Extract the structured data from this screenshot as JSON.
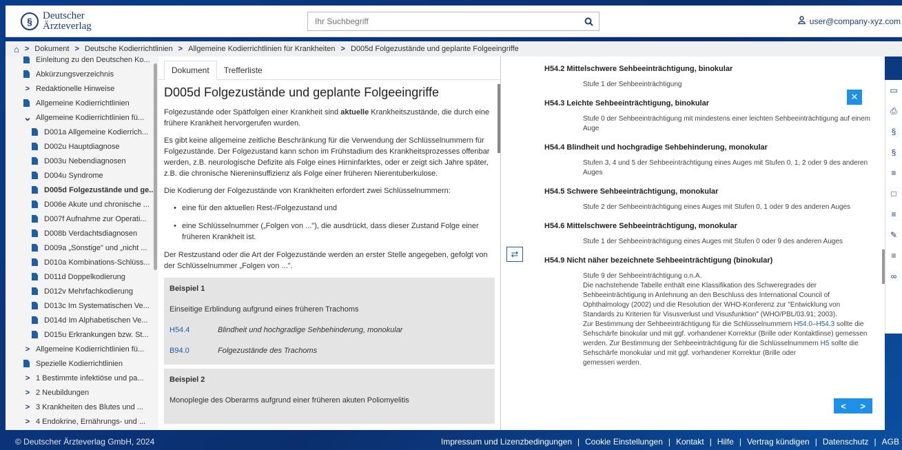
{
  "header": {
    "logo_line1": "Deutscher",
    "logo_line2": "Ärzteverlag",
    "search_placeholder": "Ihr Suchbegriff",
    "user": "user@company-xyz.com"
  },
  "breadcrumb": [
    "Dokument",
    "Deutsche Kodierrichtlinien",
    "Allgemeine Kodierrichtlinien für Krankheiten",
    "D005d Folgezustände und geplante Folgeeingriffe"
  ],
  "sidebar": {
    "items": [
      {
        "type": "doc",
        "label": "Einleitung zu den Deutschen Ko..."
      },
      {
        "type": "doc",
        "label": "Abkürzungsverzeichnis"
      },
      {
        "type": "chevron-right",
        "label": "Redaktionelle Hinweise"
      },
      {
        "type": "doc",
        "label": "Allgemeine Kodierrichtlinien"
      },
      {
        "type": "chevron-down",
        "label": "Allgemeine Kodierrichtlinien fü..."
      },
      {
        "type": "subdoc",
        "label": "D001a Allgemeine Kodierrich..."
      },
      {
        "type": "subdoc",
        "label": "D002u Hauptdiagnose"
      },
      {
        "type": "subdoc",
        "label": "D003u Nebendiagnosen"
      },
      {
        "type": "subdoc",
        "label": "D004u Syndrome"
      },
      {
        "type": "subdoc-active",
        "label": "D005d Folgezustände und ge..."
      },
      {
        "type": "subdoc",
        "label": "D006e Akute und chronische ..."
      },
      {
        "type": "subdoc",
        "label": "D007f Aufnahme zur Operati..."
      },
      {
        "type": "subdoc",
        "label": "D008b Verdachtsdiagnosen"
      },
      {
        "type": "subdoc",
        "label": "D009a „Sonstige\" und „nicht ..."
      },
      {
        "type": "subdoc",
        "label": "D010a Kombinations-Schlüss..."
      },
      {
        "type": "subdoc",
        "label": "D011d Doppelkodierung"
      },
      {
        "type": "subdoc",
        "label": "D012v Mehrfachkodierung"
      },
      {
        "type": "subdoc",
        "label": "D013c Im Systematischen Ve..."
      },
      {
        "type": "subdoc",
        "label": "D014d Im Alphabetischen Ve..."
      },
      {
        "type": "subdoc",
        "label": "D015u Erkrankungen bzw. St..."
      },
      {
        "type": "chevron-right",
        "label": "Allgemeine Kodierrichtlinien fü..."
      },
      {
        "type": "doc",
        "label": "Spezielle Kodierrichtlinien"
      },
      {
        "type": "chevron-right",
        "label": "1 Bestimmte infektiöse und pa..."
      },
      {
        "type": "chevron-right",
        "label": "2 Neubildungen"
      },
      {
        "type": "chevron-right",
        "label": "3 Krankheiten des Blutes und ..."
      },
      {
        "type": "chevron-right",
        "label": "4 Endokrine, Ernährungs- und ..."
      }
    ]
  },
  "document": {
    "tab_document": "Dokument",
    "tab_hits": "Trefferliste",
    "title": "D005d Folgezustände und geplante Folgeeingriffe",
    "p1_a": "Folgezustände oder Spätfolgen einer Krankheit sind ",
    "p1_bold": "aktuelle",
    "p1_b": " Krankheitszustände, die durch eine frühere Krankheit hervorgerufen wurden.",
    "p2": "Es gibt keine allgemeine zeitliche Beschränkung für die Verwendung der Schlüsselnummern für Folgezustände. Der Folgezustand kann schon im Frühstadium des Krankheitsprozesses offenbar werden, z.B. neurologische Defizite als Folge eines Hirninfarktes, oder er zeigt sich Jahre später, z.B. die chronische Niereninsuffizienz als Folge einer früheren Nierentuberkulose.",
    "p3": "Die Kodierung der Folgezustände von Krankheiten erfordert zwei Schlüsselnummern:",
    "li1": "eine für den aktuellen Rest-/Folgezustand und",
    "li2": "eine Schlüsselnummer („Folgen von ...\"), die ausdrückt, dass dieser Zustand Folge einer früheren Krankheit ist.",
    "p4": "Der Restzustand oder die Art der Folgezustände werden an erster Stelle angegeben, gefolgt von der Schlüsselnummer „Folgen von ...\".",
    "ex1_title": "Beispiel 1",
    "ex1_desc": "Einseitige Erblindung aufgrund eines früheren Trachoms",
    "ex1_row1_code": "H54.4",
    "ex1_row1_text": "Blindheit und hochgradige Sehbehinderung, monokular",
    "ex1_row2_code": "B94.0",
    "ex1_row2_text": "Folgezustände des Trachoms",
    "ex2_title": "Beispiel 2",
    "ex2_desc": "Monoplegie des Oberarms aufgrund einer früheren akuten Poliomyelitis"
  },
  "reference": {
    "h1": "H54.2 Mittelschwere Sehbeeinträchtigung, binokular",
    "t1": "Stufe 1 der Sehbeeinträchtigung",
    "h2": "H54.3 Leichte Sehbeeinträchtigung, binokular",
    "t2": "Stufe 0 der Sehbeeinträchtigung mit mindestens einer leichten Sehbeeinträchtigung auf einem Auge",
    "h3": "H54.4 Blindheit und hochgradige Sehbehinderung, monokular",
    "t3": "Stufen 3, 4 und 5 der Sehbeeinträchtigung eines Auges mit Stufen 0, 1, 2 oder 9 des anderen Auges",
    "h4": "H54.5 Schwere Sehbeeinträchtigung, monokular",
    "t4": "Stufe 2 der Sehbeeinträchtigung eines Auges mit Stufen 0, 1 oder 9 des anderen Auges",
    "h5": "H54.6 Mittelschwere Sehbeeinträchtigung, monokular",
    "t5": "Stufe 1 der Sehbeeinträchtigung eines Auges mit Stufen 0 oder 9 des anderen Auges",
    "h6": "H54.9 Nicht näher bezeichnete Sehbeeinträchtigung (binokular)",
    "t6_a": "Stufe 9 der Sehbeeinträchtigung o.n.A.",
    "t6_b": "Die nachstehende Tabelle enthält eine Klassifikation des Schweregrades der Sehbeeinträchtigung in Anlehnung an den Beschluss des International Council of Ophthalmology (2002) und die Resolution der WHO-Konferenz zur \"Entwicklung von Standards zu Kriterien für Visusverlust und Visusfunktion\" (WHO/PBL/03.91; 2003).",
    "t6_c1": "Zur Bestimmung der Sehbeeinträchtigung für die Schlüsselnummern ",
    "t6_link1": "H54.0",
    "t6_dash": "–",
    "t6_link2": "H54.3",
    "t6_c2": " sollte die Sehschärfe binokular und mit ggf. vorhandener Korrektur (Brille oder Kontaktlinse) gemessen werden. Zur Bestimmung der Sehbeeinträchtigung für die Schlüsselnummern ",
    "t6_link3": "H5",
    "t6_c3": " sollte die Sehschärfe monokular und mit ggf. vorhandener Korrektur (Brille oder ",
    "t6_c4": "gemessen werden."
  },
  "footer": {
    "copyright": "© Deutscher Ärzteverlag GmbH, 2024",
    "links": [
      "Impressum und Lizenzbedingungen",
      "Cookie Einstellungen",
      "Kontakt",
      "Hilfe",
      "Vertrag kündigen",
      "Datenschutz",
      "AGB"
    ]
  },
  "colors": {
    "brand": "#1a3d7c",
    "accent": "#1e90e6",
    "link": "#1a5fa8"
  }
}
